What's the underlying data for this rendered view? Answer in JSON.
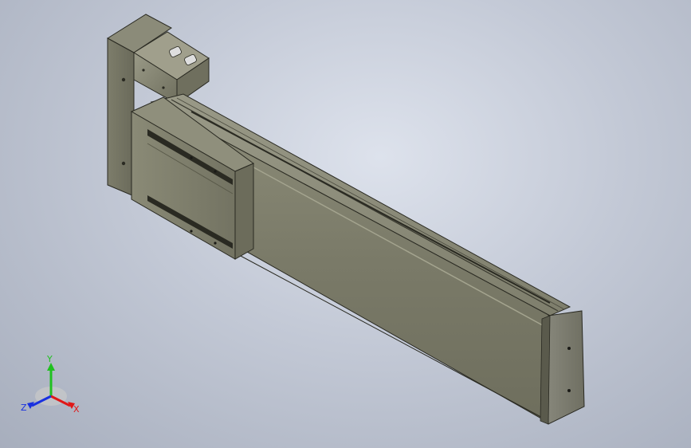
{
  "viewport": {
    "background": "#b9bfcc"
  },
  "model": {
    "body_color": "#767664",
    "edge_color": "#2a2a22"
  },
  "triad": {
    "x_label": "X",
    "y_label": "Y",
    "z_label": "Z",
    "x_color": "#e01818",
    "y_color": "#20c020",
    "z_color": "#1830e0"
  }
}
